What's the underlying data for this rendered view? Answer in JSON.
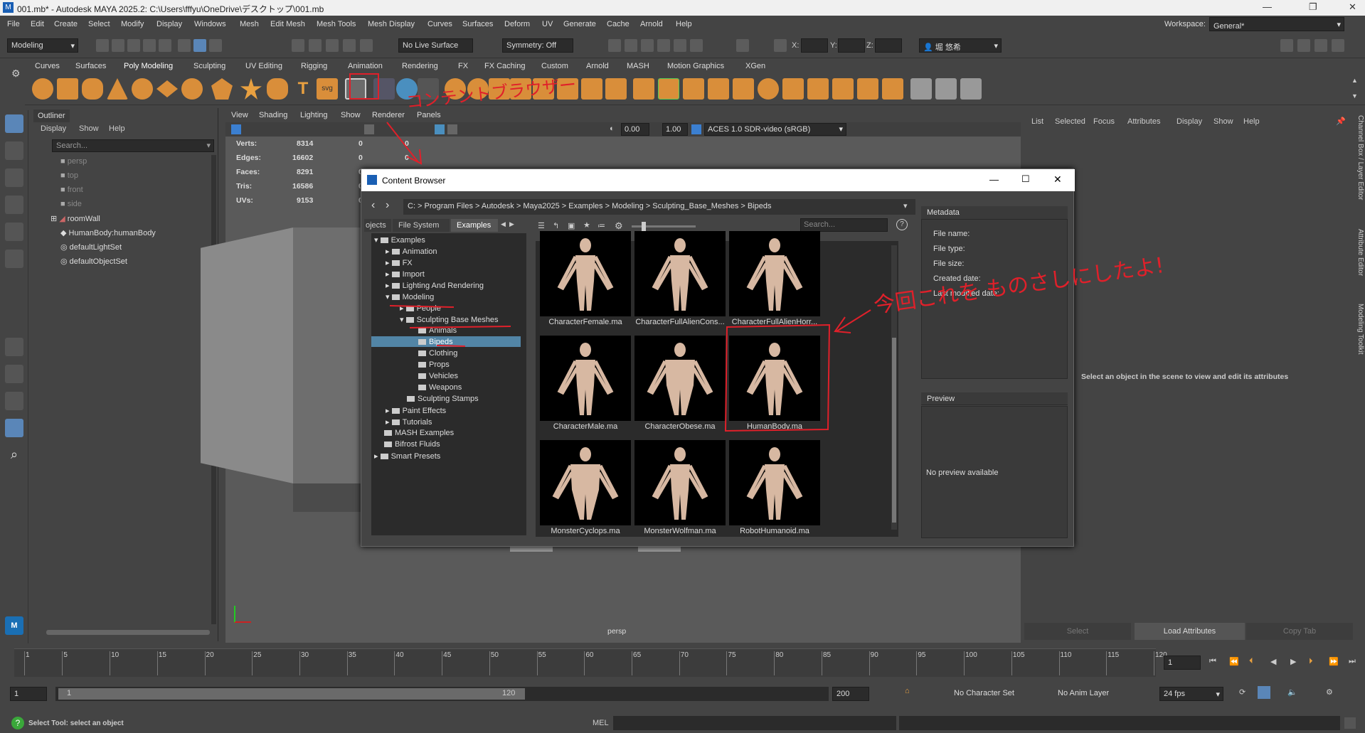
{
  "title": "001.mb* - Autodesk MAYA 2025.2: C:\\Users\\fffyu\\OneDrive\\デスクトップ\\001.mb",
  "menus": [
    "File",
    "Edit",
    "Create",
    "Select",
    "Modify",
    "Display",
    "Windows",
    "Mesh",
    "Edit Mesh",
    "Mesh Tools",
    "Mesh Display",
    "Curves",
    "Surfaces",
    "Deform",
    "UV",
    "Generate",
    "Cache",
    "Arnold",
    "Help"
  ],
  "workspace": {
    "label": "Workspace:",
    "value": "General*"
  },
  "status": {
    "mode": "Modeling",
    "live_surface": "No Live Surface",
    "symmetry": "Symmetry: Off",
    "x": "X:",
    "y": "Y:",
    "z": "Z:",
    "user": "堀 悠希"
  },
  "shelf_tabs": [
    "Curves",
    "Surfaces",
    "Poly Modeling",
    "Sculpting",
    "UV Editing",
    "Rigging",
    "Animation",
    "Rendering",
    "FX",
    "FX Caching",
    "Custom",
    "Arnold",
    "MASH",
    "Motion Graphics",
    "XGen"
  ],
  "outliner": {
    "title": "Outliner",
    "menu": [
      "Display",
      "Show",
      "Help"
    ],
    "search": "Search...",
    "items": [
      "persp",
      "top",
      "front",
      "side",
      "roomWall",
      "HumanBody:humanBody",
      "defaultLightSet",
      "defaultObjectSet"
    ]
  },
  "viewport": {
    "menu": [
      "View",
      "Shading",
      "Lighting",
      "Show",
      "Renderer",
      "Panels"
    ],
    "hud": [
      [
        "Verts:",
        "8314",
        "0",
        "0"
      ],
      [
        "Edges:",
        "16602",
        "0",
        "0"
      ],
      [
        "Faces:",
        "8291",
        "0",
        "0"
      ],
      [
        "Tris:",
        "16586",
        "0",
        "0"
      ],
      [
        "UVs:",
        "9153",
        "0",
        "0"
      ]
    ],
    "camera": "persp",
    "exposure": "0.00",
    "gamma": "1.00",
    "colorspace": "ACES 1.0 SDR-video (sRGB)"
  },
  "content_browser": {
    "title": "Content Browser",
    "crumbs": "C:  >  Program Files  >  Autodesk  >  Maya2025  >  Examples  >  Modeling  >  Sculpting_Base_Meshes  >  Bipeds",
    "tabs": [
      "ojects",
      "File System",
      "Examples"
    ],
    "search": "Search...",
    "tree": [
      "Examples",
      "Animation",
      "FX",
      "Import",
      "Lighting And Rendering",
      "Modeling",
      "People",
      "Sculpting Base Meshes",
      "Animals",
      "Bipeds",
      "Clothing",
      "Props",
      "Vehicles",
      "Weapons",
      "Sculpting Stamps",
      "Paint Effects",
      "Tutorials",
      "MASH Examples",
      "Bifrost Fluids",
      "Smart Presets"
    ],
    "files": [
      "CharacterFemale.ma",
      "CharacterFullAlienCons...",
      "CharacterFullAlienHorr...",
      "CharacterMale.ma",
      "CharacterObese.ma",
      "HumanBody.ma",
      "MonsterCyclops.ma",
      "MonsterWolfman.ma",
      "RobotHumanoid.ma"
    ],
    "metadata": {
      "title": "Metadata",
      "fields": [
        "File name:",
        "File type:",
        "File size:",
        "Created date:",
        "Last modified date:"
      ]
    },
    "preview": {
      "title": "Preview",
      "empty": "No preview available"
    }
  },
  "attr_editor": {
    "menu": [
      "List",
      "Selected",
      "Focus",
      "Attributes",
      "Display",
      "Show",
      "Help"
    ],
    "message": "Select an object in the scene to view and edit its attributes",
    "buttons": [
      "Select",
      "Load Attributes",
      "Copy Tab"
    ],
    "side_tabs": [
      "Channel Box / Layer Editor",
      "Attribute Editor",
      "Modeling Toolkit"
    ]
  },
  "timeline": {
    "ticks": [
      "1",
      "5",
      "10",
      "15",
      "20",
      "25",
      "30",
      "35",
      "40",
      "45",
      "50",
      "55",
      "60",
      "65",
      "70",
      "75",
      "80",
      "85",
      "90",
      "95",
      "100",
      "105",
      "110",
      "115",
      "120"
    ],
    "current": "1"
  },
  "range": {
    "start": "1",
    "inner_start": "1",
    "inner_end": "120",
    "end": "200",
    "character_set": "No Character Set",
    "anim_layer": "No Anim Layer",
    "fps": "24 fps"
  },
  "cmd": {
    "help": "Select Tool: select an object",
    "lang": "MEL"
  },
  "annotations": {
    "content_browser_label": "コンテントブラウザー",
    "note": "今回これを ものさしにしたよ!"
  }
}
